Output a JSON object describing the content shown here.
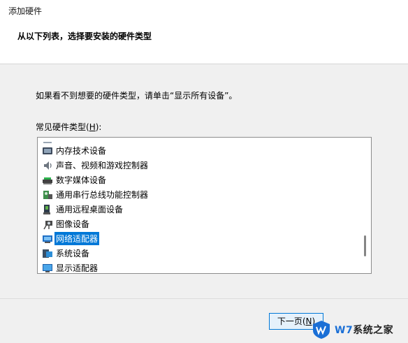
{
  "window": {
    "title": "添加硬件"
  },
  "header": {
    "heading": "从以下列表，选择要安装的硬件类型"
  },
  "hint": "如果看不到想要的硬件类型，请单击“显示所有设备”。",
  "list_label": {
    "pre": "常见硬件类型(",
    "mnemonic": "H",
    "post": "):"
  },
  "items": [
    {
      "label": "内存技术设备",
      "icon": "memory-card-icon"
    },
    {
      "label": "声音、视频和游戏控制器",
      "icon": "speaker-icon"
    },
    {
      "label": "数字媒体设备",
      "icon": "digital-media-icon"
    },
    {
      "label": "通用串行总线功能控制器",
      "icon": "usb-controller-icon"
    },
    {
      "label": "通用远程桌面设备",
      "icon": "remote-desktop-icon"
    },
    {
      "label": "图像设备",
      "icon": "camera-icon"
    },
    {
      "label": "网络适配器",
      "icon": "network-adapter-icon",
      "selected": true
    },
    {
      "label": "系统设备",
      "icon": "system-device-icon"
    },
    {
      "label": "显示适配器",
      "icon": "display-adapter-icon"
    }
  ],
  "buttons": {
    "next_pre": "下一页(",
    "next_mnemonic": "N",
    "next_post": ")"
  },
  "watermark": {
    "brand": "W7",
    "text": "系统之家"
  },
  "colors": {
    "selection": "#0078d7",
    "background": "#f0f0f0"
  }
}
